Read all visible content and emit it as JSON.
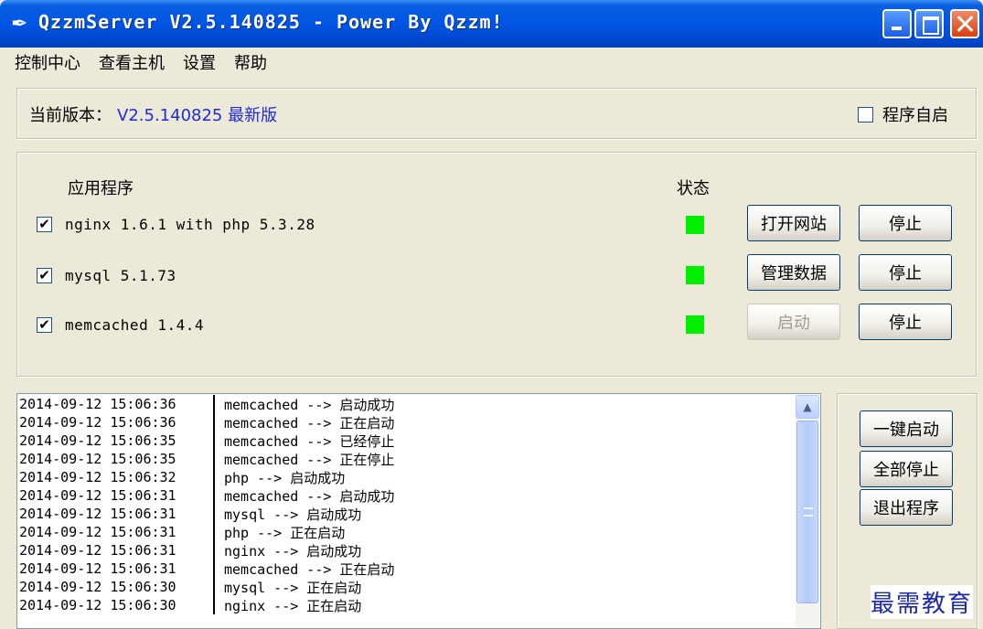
{
  "window": {
    "icon": "feather-icon",
    "title": "QzzmServer V2.5.140825 - Power By Qzzm!"
  },
  "menu": [
    "控制中心",
    "查看主机",
    "设置",
    "帮助"
  ],
  "version": {
    "label": "当前版本：",
    "value": "V2.5.140825 最新版",
    "autostart_label": "程序自启",
    "autostart_checked": false
  },
  "apps": {
    "header_name": "应用程序",
    "header_status": "状态",
    "status_color": "#00ee00",
    "rows": [
      {
        "checked": true,
        "name": "nginx 1.6.1 with php 5.3.28",
        "status": "running",
        "action_label": "打开网站",
        "action_enabled": true,
        "stop_label": "停止"
      },
      {
        "checked": true,
        "name": "mysql 5.1.73",
        "status": "running",
        "action_label": "管理数据",
        "action_enabled": true,
        "stop_label": "停止"
      },
      {
        "checked": true,
        "name": "memcached 1.4.4",
        "status": "running",
        "action_label": "启动",
        "action_enabled": false,
        "stop_label": "停止"
      }
    ]
  },
  "log": [
    {
      "time": "2014-09-12 15:06:36",
      "msg": "memcached --> 启动成功"
    },
    {
      "time": "2014-09-12 15:06:36",
      "msg": "memcached --> 正在启动"
    },
    {
      "time": "2014-09-12 15:06:35",
      "msg": "memcached --> 已经停止"
    },
    {
      "time": "2014-09-12 15:06:35",
      "msg": "memcached --> 正在停止"
    },
    {
      "time": "2014-09-12 15:06:32",
      "msg": "php --> 启动成功"
    },
    {
      "time": "2014-09-12 15:06:31",
      "msg": "memcached --> 启动成功"
    },
    {
      "time": "2014-09-12 15:06:31",
      "msg": "mysql --> 启动成功"
    },
    {
      "time": "2014-09-12 15:06:31",
      "msg": "php --> 正在启动"
    },
    {
      "time": "2014-09-12 15:06:31",
      "msg": "nginx --> 启动成功"
    },
    {
      "time": "2014-09-12 15:06:31",
      "msg": "memcached --> 正在启动"
    },
    {
      "time": "2014-09-12 15:06:30",
      "msg": "mysql --> 正在启动"
    },
    {
      "time": "2014-09-12 15:06:30",
      "msg": "nginx --> 正在启动"
    }
  ],
  "actions": {
    "start_all": "一键启动",
    "stop_all": "全部停止",
    "exit": "退出程序"
  },
  "watermark": "最需教育"
}
